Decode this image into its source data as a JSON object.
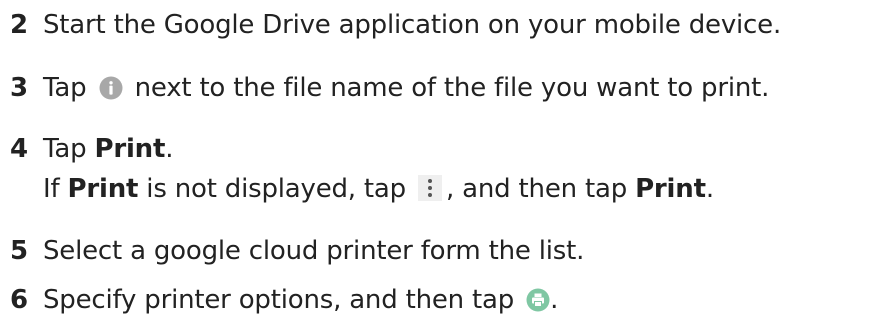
{
  "steps": [
    {
      "number": "2",
      "text": "Start the Google Drive application on your mobile device."
    },
    {
      "number": "3",
      "before_icon": "Tap",
      "icon": "info-icon",
      "after_icon": "next to the file name of the file you want to print."
    },
    {
      "number": "4",
      "before_bold": "Tap ",
      "bold": "Print",
      "after_bold": ".",
      "note": {
        "part1": "If ",
        "bold1": "Print",
        "part2": " is not displayed, tap",
        "icon": "more-vert-icon",
        "part3": ", and then tap ",
        "bold2": "Print",
        "part4": "."
      }
    },
    {
      "number": "5",
      "text": "Select a google cloud printer form the list."
    },
    {
      "number": "6",
      "before_icon": "Specify printer options, and then tap",
      "icon": "print-icon",
      "after_icon": "."
    }
  ],
  "colors": {
    "text": "#222222",
    "info_icon": "#a8a8a8",
    "print_icon": "#7fc7a3"
  }
}
